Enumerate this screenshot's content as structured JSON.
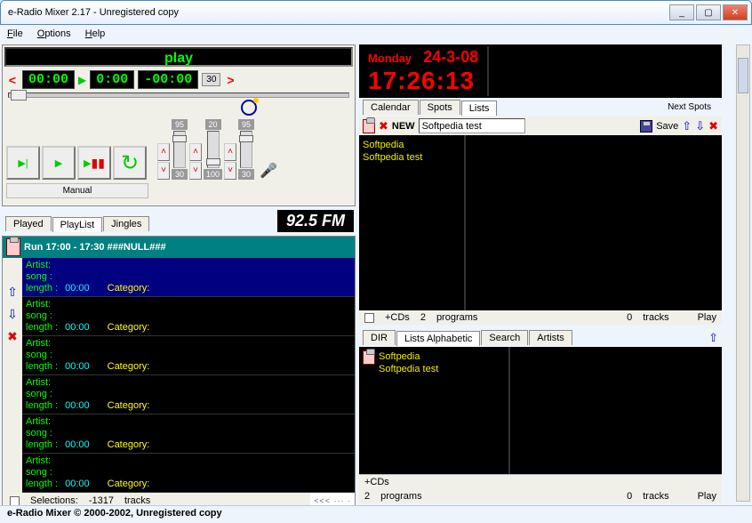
{
  "window": {
    "title": "e-Radio Mixer 2.17 - Unregistered copy"
  },
  "menu": {
    "file": "File",
    "options": "Options",
    "help": "Help"
  },
  "player": {
    "status": "play",
    "t1": "00:00",
    "t2": "0:00",
    "t3": "00:00",
    "count": "30",
    "vol1top": "95",
    "vol1bot": "30",
    "vol2top": "20",
    "vol2bot": "100",
    "vol3top": "95",
    "vol3bot": "30",
    "mode": "Manual"
  },
  "fm": "92.5 FM",
  "pltabs": {
    "played": "Played",
    "playlist": "PlayList",
    "jingles": "Jingles"
  },
  "playlist": {
    "header": "Run  17:00 - 17:30     ###NULL###",
    "rows": [
      {
        "artist": "Artist:",
        "song": "song :",
        "len": "length :",
        "time": "00:00",
        "cat": "Category:"
      },
      {
        "artist": "Artist:",
        "song": "song :",
        "len": "length :",
        "time": "00:00",
        "cat": "Category:"
      },
      {
        "artist": "Artist:",
        "song": "song :",
        "len": "length :",
        "time": "00:00",
        "cat": "Category:"
      },
      {
        "artist": "Artist:",
        "song": "song :",
        "len": "length :",
        "time": "00:00",
        "cat": "Category:"
      },
      {
        "artist": "Artist:",
        "song": "song :",
        "len": "length :",
        "time": "00:00",
        "cat": "Category:"
      },
      {
        "artist": "Artist:",
        "song": "song :",
        "len": "length :",
        "time": "00:00",
        "cat": "Category:"
      }
    ],
    "sel_label": "Selections:",
    "tracks_count": "-1317",
    "tracks_label": "tracks",
    "pager": "<<< ··· ·"
  },
  "clock": {
    "day": "Monday",
    "date": "24-3-08",
    "time": "17:26:13"
  },
  "righttabs": {
    "calendar": "Calendar",
    "spots": "Spots",
    "lists": "Lists",
    "next": "Next Spots"
  },
  "newbar": {
    "new": "NEW",
    "value": "Softpedia test",
    "save": "Save"
  },
  "upperlist": {
    "items": [
      "Softpedia",
      "Softpedia test"
    ],
    "cds": "+CDs",
    "programs_n": "2",
    "programs": "programs",
    "tracks_n": "0",
    "tracks": "tracks",
    "play": "Play"
  },
  "lowertabs": {
    "dir": "DIR",
    "alpha": "Lists Alphabetic",
    "search": "Search",
    "artists": "Artists"
  },
  "lowerlist": {
    "items": [
      "Softpedia",
      "Softpedia test"
    ],
    "cds": "+CDs",
    "programs_n": "2",
    "programs": "programs",
    "tracks_n": "0",
    "tracks": "tracks",
    "play": "Play"
  },
  "status": "e-Radio Mixer © 2000-2002, Unregistered copy"
}
